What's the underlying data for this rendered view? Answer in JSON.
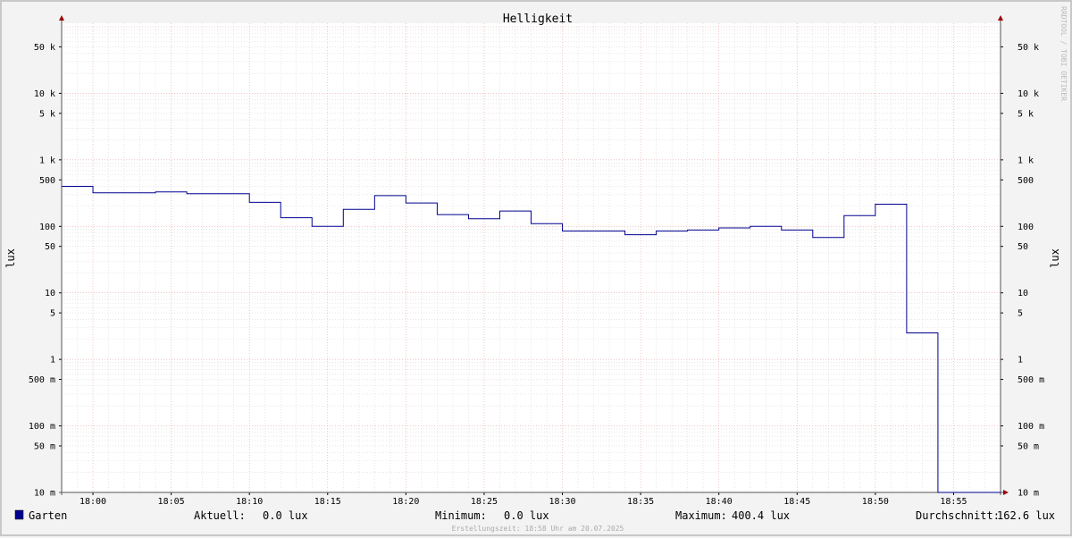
{
  "chart_data": {
    "type": "line",
    "title": "Helligkeit",
    "ylabel": "lux",
    "ylabel_right": "lux",
    "y_scale": "log",
    "ylim": [
      0.01,
      100000
    ],
    "y_ticks": [
      {
        "value": 50000,
        "label": "50 k"
      },
      {
        "value": 10000,
        "label": "10 k"
      },
      {
        "value": 5000,
        "label": "5 k"
      },
      {
        "value": 1000,
        "label": "1 k"
      },
      {
        "value": 500,
        "label": "500"
      },
      {
        "value": 100,
        "label": "100"
      },
      {
        "value": 50,
        "label": "50"
      },
      {
        "value": 10,
        "label": "10"
      },
      {
        "value": 5,
        "label": "5"
      },
      {
        "value": 1,
        "label": "1"
      },
      {
        "value": 0.5,
        "label": "500 m"
      },
      {
        "value": 0.1,
        "label": "100 m"
      },
      {
        "value": 0.05,
        "label": "50 m"
      },
      {
        "value": 0.01,
        "label": "10 m"
      }
    ],
    "xlim": [
      "17:58",
      "18:58"
    ],
    "x_ticks": [
      "18:00",
      "18:05",
      "18:10",
      "18:15",
      "18:20",
      "18:25",
      "18:30",
      "18:35",
      "18:40",
      "18:45",
      "18:50",
      "18:55"
    ],
    "grid": true,
    "line_color": "#000080",
    "series": [
      {
        "name": "Garten",
        "color": "#000090",
        "step_points": [
          {
            "t": "17:58",
            "v": 400
          },
          {
            "t": "18:00",
            "v": 320
          },
          {
            "t": "18:04",
            "v": 330
          },
          {
            "t": "18:06",
            "v": 310
          },
          {
            "t": "18:10",
            "v": 230
          },
          {
            "t": "18:12",
            "v": 135
          },
          {
            "t": "18:14",
            "v": 100
          },
          {
            "t": "18:16",
            "v": 180
          },
          {
            "t": "18:18",
            "v": 290
          },
          {
            "t": "18:20",
            "v": 225
          },
          {
            "t": "18:22",
            "v": 150
          },
          {
            "t": "18:24",
            "v": 130
          },
          {
            "t": "18:26",
            "v": 170
          },
          {
            "t": "18:28",
            "v": 110
          },
          {
            "t": "18:30",
            "v": 85
          },
          {
            "t": "18:34",
            "v": 75
          },
          {
            "t": "18:36",
            "v": 85
          },
          {
            "t": "18:38",
            "v": 88
          },
          {
            "t": "18:40",
            "v": 95
          },
          {
            "t": "18:42",
            "v": 100
          },
          {
            "t": "18:44",
            "v": 88
          },
          {
            "t": "18:46",
            "v": 68
          },
          {
            "t": "18:48",
            "v": 145
          },
          {
            "t": "18:50",
            "v": 215
          },
          {
            "t": "18:52",
            "v": 2.5
          },
          {
            "t": "18:54",
            "v": 0.0
          },
          {
            "t": "18:58",
            "v": 0.0
          }
        ]
      }
    ]
  },
  "legend": {
    "series_name": "Garten",
    "swatch_color": "#000090",
    "current_label": "Aktuell:",
    "current_value": "0.0 lux",
    "min_label": "Minimum:",
    "min_value": "0.0 lux",
    "max_label": "Maximum:",
    "max_value": "400.4 lux",
    "avg_label": "Durchschnitt:",
    "avg_value": "162.6 lux"
  },
  "footer": "Erstellungszeit: 18:58 Uhr am 20.07.2025",
  "watermark": "RRDTOOL / TOBI OETIKER"
}
